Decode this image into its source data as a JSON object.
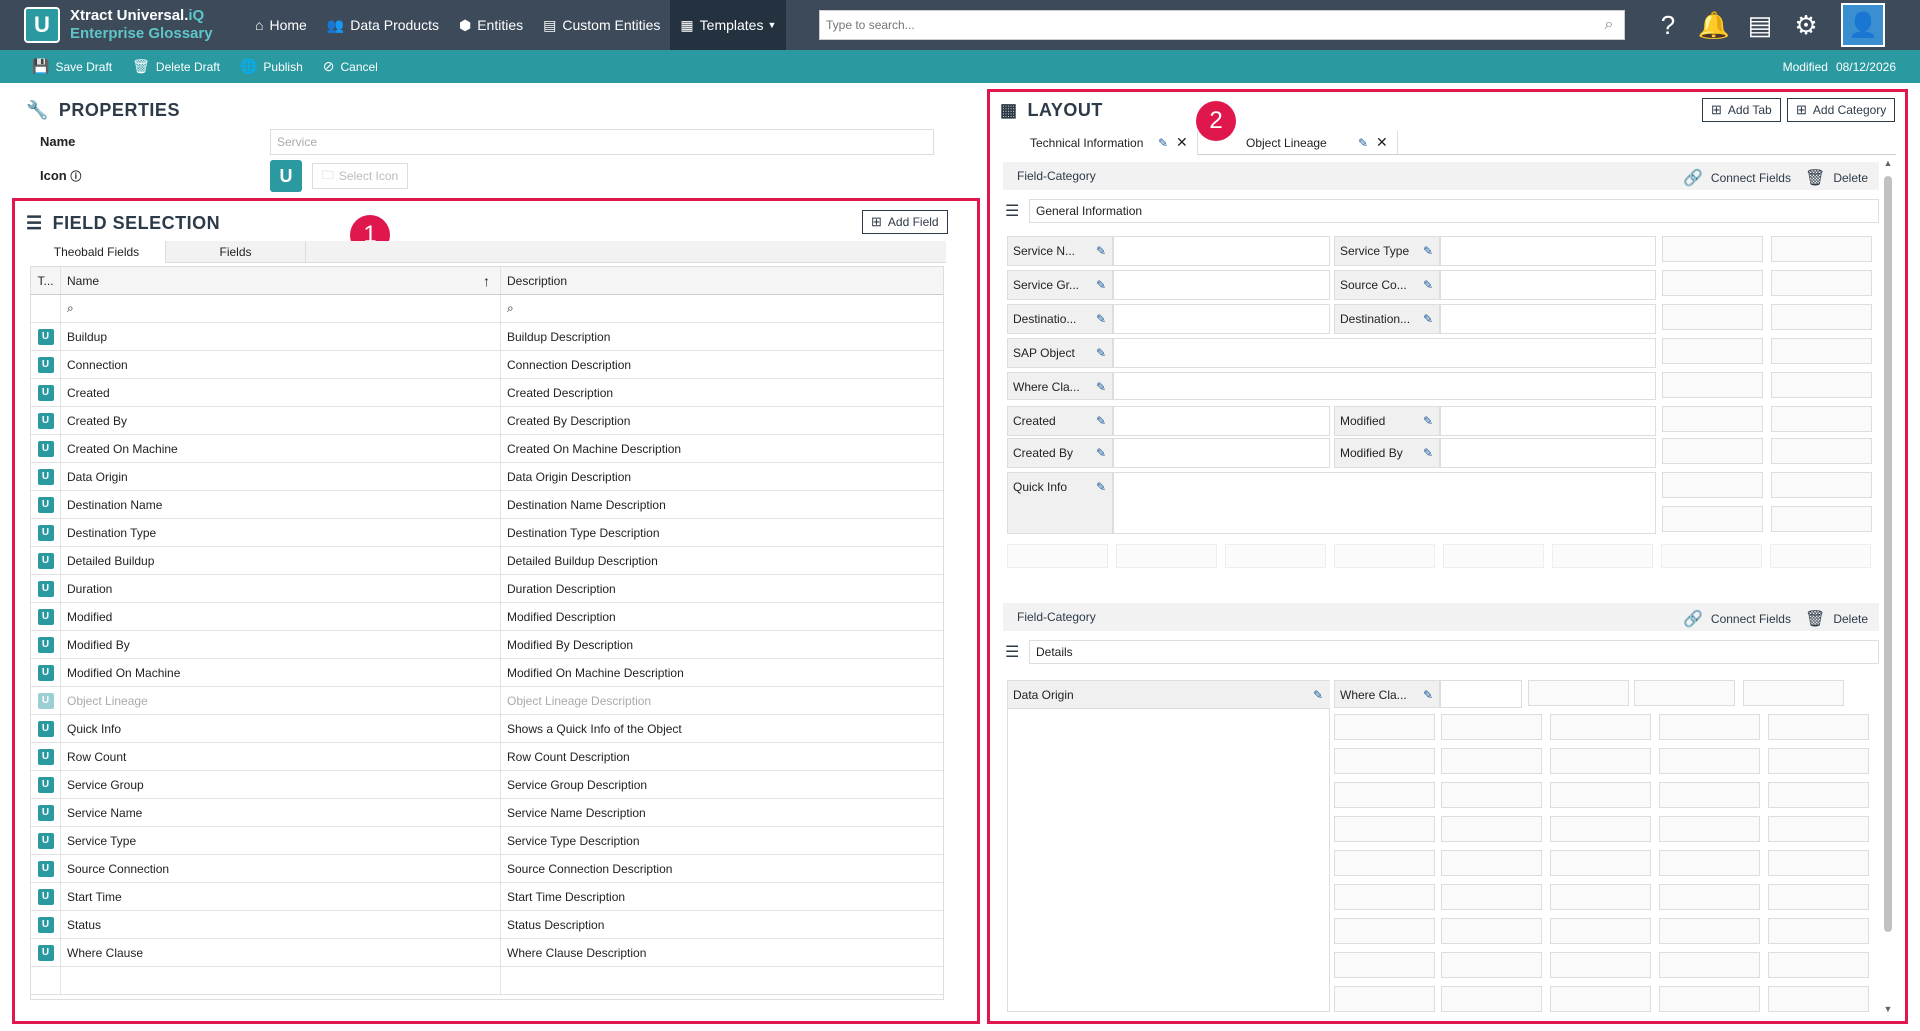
{
  "topnav": {
    "brand_name": "Xtract Universal.",
    "brand_name_iq": "iQ",
    "brand_sub": "Enterprise Glossary",
    "items": [
      {
        "label": "Home",
        "icon": "home-icon"
      },
      {
        "label": "Data Products",
        "icon": "users-icon"
      },
      {
        "label": "Entities",
        "icon": "cube-icon"
      },
      {
        "label": "Custom Entities",
        "icon": "file-icon"
      },
      {
        "label": "Templates",
        "icon": "grid-icon",
        "active": true
      }
    ],
    "search_placeholder": "Type to search...",
    "icons": [
      "help-icon",
      "bell-icon",
      "book-icon",
      "gear-icon",
      "user-avatar-icon"
    ]
  },
  "actionbar": {
    "save_draft": "Save Draft",
    "delete_draft": "Delete Draft",
    "publish": "Publish",
    "cancel": "Cancel",
    "modified_label": "Modified",
    "modified_date": "08/12/2026"
  },
  "properties": {
    "title": "PROPERTIES",
    "name_label": "Name",
    "name_placeholder": "Service",
    "icon_label": "Icon",
    "select_icon": "Select Icon"
  },
  "field_selection": {
    "title": "FIELD SELECTION",
    "add_field": "Add Field",
    "tabs": [
      "Theobald Fields",
      "Fields"
    ],
    "col_type": "T...",
    "col_name": "Name",
    "col_desc": "Description",
    "rows": [
      {
        "name": "Buildup",
        "desc": "Buildup Description"
      },
      {
        "name": "Connection",
        "desc": "Connection Description"
      },
      {
        "name": "Created",
        "desc": "Created Description"
      },
      {
        "name": "Created By",
        "desc": "Created By Description"
      },
      {
        "name": "Created On Machine",
        "desc": "Created On Machine Description"
      },
      {
        "name": "Data Origin",
        "desc": "Data Origin Description"
      },
      {
        "name": "Destination Name",
        "desc": "Destination Name Description"
      },
      {
        "name": "Destination Type",
        "desc": "Destination Type Description"
      },
      {
        "name": "Detailed Buildup",
        "desc": "Detailed Buildup Description"
      },
      {
        "name": "Duration",
        "desc": "Duration Description"
      },
      {
        "name": "Modified",
        "desc": "Modified Description"
      },
      {
        "name": "Modified By",
        "desc": "Modified By Description"
      },
      {
        "name": "Modified On Machine",
        "desc": "Modified On Machine Description"
      },
      {
        "name": "Object Lineage",
        "desc": "Object Lineage Description",
        "disabled": true
      },
      {
        "name": "Quick Info",
        "desc": "Shows a Quick Info of the Object"
      },
      {
        "name": "Row Count",
        "desc": "Row Count Description"
      },
      {
        "name": "Service Group",
        "desc": "Service Group Description"
      },
      {
        "name": "Service Name",
        "desc": "Service Name Description"
      },
      {
        "name": "Service Type",
        "desc": "Service Type Description"
      },
      {
        "name": "Source Connection",
        "desc": "Source Connection Description"
      },
      {
        "name": "Start Time",
        "desc": "Start Time Description"
      },
      {
        "name": "Status",
        "desc": "Status Description"
      },
      {
        "name": "Where Clause",
        "desc": "Where Clause Description"
      }
    ]
  },
  "layout": {
    "title": "LAYOUT",
    "add_tab": "Add Tab",
    "add_category": "Add Category",
    "tabs": [
      "Technical Information",
      "Object Lineage"
    ],
    "categories": [
      {
        "header": "Field-Category",
        "connect": "Connect Fields",
        "delete": "Delete",
        "name": "General Information",
        "fields": [
          "Service N...",
          "Service Type",
          "Service Gr...",
          "Source Co...",
          "Destinatio...",
          "Destination...",
          "SAP Object",
          "Where Cla...",
          "Created",
          "Modified",
          "Created By",
          "Modified By",
          "Quick Info"
        ]
      },
      {
        "header": "Field-Category",
        "connect": "Connect Fields",
        "delete": "Delete",
        "name": "Details",
        "fields": [
          "Data Origin",
          "Where Cla..."
        ]
      }
    ]
  },
  "annotations": {
    "badge1": "1",
    "badge2": "2"
  },
  "colors": {
    "nav": "#3c4a5a",
    "teal": "#2a9aa0",
    "highlight": "#e0174d",
    "pen": "#1d5a9a"
  }
}
